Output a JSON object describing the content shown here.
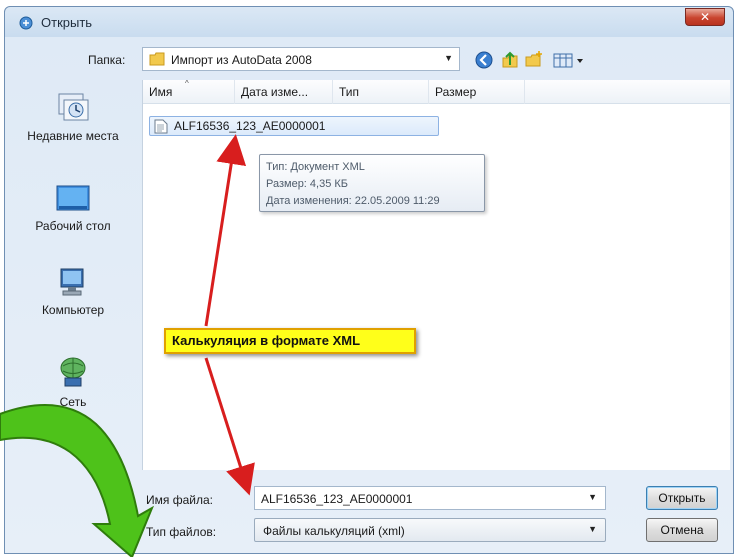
{
  "window": {
    "title": "Открыть",
    "close_glyph": "✕"
  },
  "lookin": {
    "label": "Папка:",
    "value": "Импорт из AutoData 2008",
    "dropdown_glyph": "▼"
  },
  "toolbar": {
    "icons": [
      "back-icon",
      "up-folder-icon",
      "new-folder-icon",
      "views-menu-icon"
    ]
  },
  "places": [
    {
      "label": "Недавние места",
      "icon": "recent-places-icon"
    },
    {
      "label": "Рабочий стол",
      "icon": "desktop-icon"
    },
    {
      "label": "Компьютер",
      "icon": "computer-icon"
    },
    {
      "label": "Сеть",
      "icon": "network-icon"
    }
  ],
  "columns": {
    "name": "Имя",
    "date": "Дата изме...",
    "type": "Тип",
    "size": "Размер",
    "sort_glyph": "^"
  },
  "files": [
    {
      "name": "ALF16536_123_AE0000001",
      "icon": "xml-file-icon"
    }
  ],
  "tooltip": {
    "line1": "Тип: Документ XML",
    "line2": "Размер: 4,35 КБ",
    "line3": "Дата изменения: 22.05.2009 11:29"
  },
  "callout": {
    "text": "Калькуляция в формате XML"
  },
  "filename": {
    "label": "Имя файла:",
    "value": "ALF16536_123_AE0000001",
    "dropdown_glyph": "▼"
  },
  "filetype": {
    "label": "Тип файлов:",
    "value": "Файлы калькуляций (xml)",
    "dropdown_glyph": "▼"
  },
  "buttons": {
    "open": "Открыть",
    "cancel": "Отмена"
  },
  "colors": {
    "annotation_arrow": "#d81e1e",
    "big_arrow": "#4ec21a",
    "callout_bg": "#ffff1a"
  }
}
